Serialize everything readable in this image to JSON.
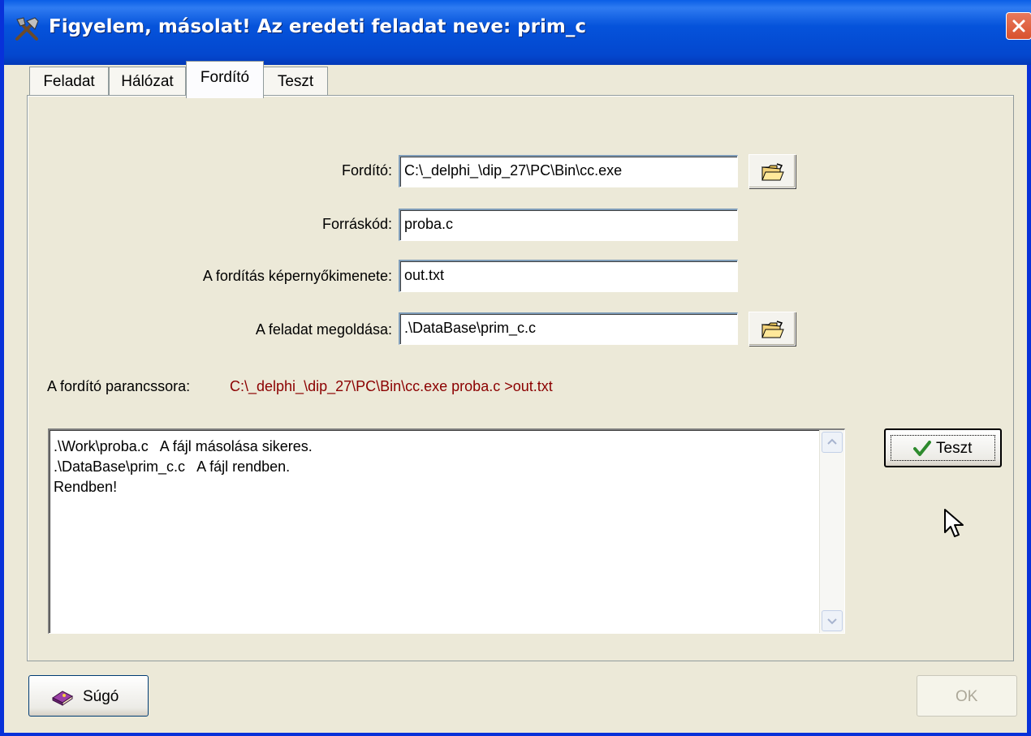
{
  "window": {
    "title": "Figyelem, másolat! Az eredeti feladat neve: prim_c"
  },
  "tabs": [
    {
      "label": "Feladat",
      "active": false
    },
    {
      "label": "Hálózat",
      "active": false
    },
    {
      "label": "Fordító",
      "active": true
    },
    {
      "label": "Teszt",
      "active": false
    }
  ],
  "form": {
    "compiler": {
      "label": "Fordító:",
      "value": "C:\\_delphi_\\dip_27\\PC\\Bin\\cc.exe"
    },
    "source": {
      "label": "Forráskód:",
      "value": "proba.c"
    },
    "output": {
      "label": "A fordítás képernyőkimenete:",
      "value": "out.txt"
    },
    "solution": {
      "label": "A feladat megoldása:",
      "value": ".\\DataBase\\prim_c.c"
    }
  },
  "command": {
    "label": "A fordító parancssora:",
    "value": "C:\\_delphi_\\dip_27\\PC\\Bin\\cc.exe proba.c >out.txt"
  },
  "log": {
    "lines": [
      ".\\Work\\proba.c   A fájl másolása sikeres.",
      ".\\DataBase\\prim_c.c   A fájl rendben.",
      "Rendben!"
    ]
  },
  "buttons": {
    "test": "Teszt",
    "help": "Súgó",
    "ok": "OK"
  },
  "icons": {
    "title": "tools-icon",
    "browse": "open-folder-icon",
    "test": "checkmark-icon",
    "help": "help-book-icon"
  },
  "colors": {
    "titlebar": "#0553DB",
    "command_text": "#8B0000",
    "checkmark": "#2E8B2E"
  }
}
